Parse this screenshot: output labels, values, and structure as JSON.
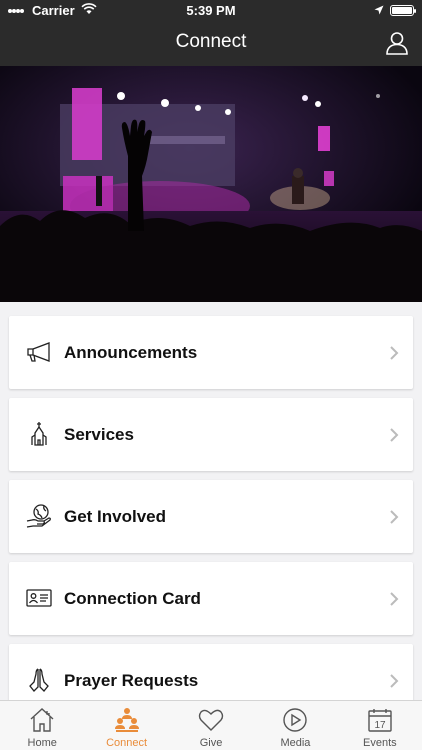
{
  "status_bar": {
    "carrier": "Carrier",
    "time": "5:39 PM"
  },
  "nav": {
    "title": "Connect"
  },
  "menu": [
    {
      "label": "Announcements",
      "icon": "megaphone-icon"
    },
    {
      "label": "Services",
      "icon": "church-icon"
    },
    {
      "label": "Get Involved",
      "icon": "globe-hand-icon"
    },
    {
      "label": "Connection Card",
      "icon": "id-card-icon"
    },
    {
      "label": "Prayer Requests",
      "icon": "praying-hands-icon"
    }
  ],
  "tabs": [
    {
      "label": "Home",
      "icon": "home-icon",
      "active": false
    },
    {
      "label": "Connect",
      "icon": "people-icon",
      "active": true
    },
    {
      "label": "Give",
      "icon": "heart-icon",
      "active": false
    },
    {
      "label": "Media",
      "icon": "play-icon",
      "active": false
    },
    {
      "label": "Events",
      "icon": "calendar-icon",
      "active": false,
      "date": "17"
    }
  ],
  "colors": {
    "accent": "#e98c3a",
    "nav_bg": "#2b2b2b",
    "page_bg": "#f2f2f4"
  }
}
